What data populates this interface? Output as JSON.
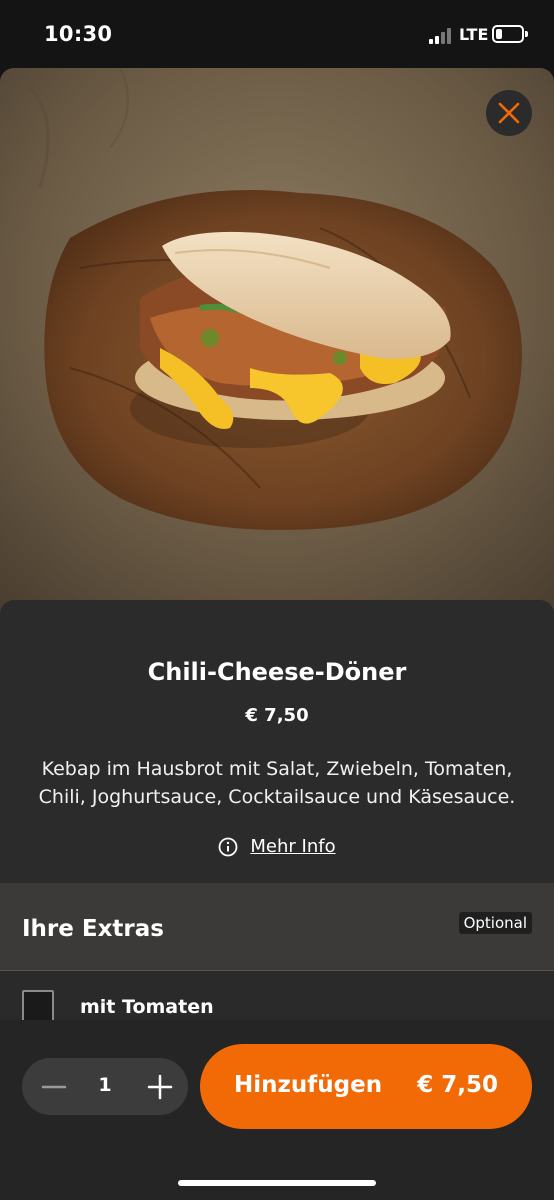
{
  "status_bar": {
    "time": "10:30",
    "network": "LTE",
    "battery_level": 0.25,
    "icons": [
      "signal-bars-icon",
      "battery-icon"
    ]
  },
  "hero": {
    "image_alt": "Chili-Cheese-Döner",
    "close_icon": "close-icon",
    "accent_color": "#f26a06"
  },
  "product": {
    "title": "Chili-Cheese-Döner",
    "price": "€ 7,50",
    "description": "Kebap im Hausbrot mit Salat, Zwiebeln, Tomaten, Chili, Joghurtsauce, Cocktailsauce und Käsesauce.",
    "more_info_label": "Mehr Info",
    "more_info_icon": "info-icon"
  },
  "extras": {
    "title": "Ihre Extras",
    "badge": "Optional",
    "items": [
      {
        "label": "mit Tomaten",
        "checked": false
      }
    ]
  },
  "order_bar": {
    "quantity": "1",
    "minus_icon": "minus-icon",
    "plus_icon": "plus-icon",
    "add_label": "Hinzufügen",
    "add_price": "€ 7,50",
    "button_color": "#f26a06"
  }
}
